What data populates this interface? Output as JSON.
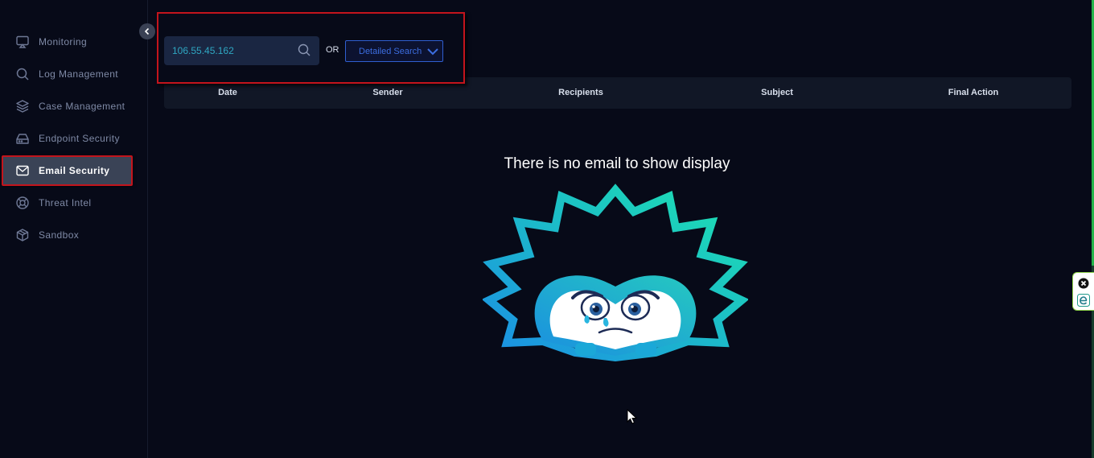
{
  "sidebar": {
    "items": [
      {
        "label": "Monitoring",
        "icon": "monitor-icon"
      },
      {
        "label": "Log Management",
        "icon": "search-icon"
      },
      {
        "label": "Case Management",
        "icon": "layers-icon"
      },
      {
        "label": "Endpoint Security",
        "icon": "hard-drive-icon"
      },
      {
        "label": "Email Security",
        "icon": "mail-icon",
        "active": true
      },
      {
        "label": "Threat Intel",
        "icon": "lifebuoy-icon"
      },
      {
        "label": "Sandbox",
        "icon": "box-icon"
      }
    ]
  },
  "search": {
    "value": "106.55.45.162",
    "or_label": "OR",
    "detailed_search_label": "Detailed Search"
  },
  "table": {
    "columns": [
      "Date",
      "Sender",
      "Recipients",
      "Subject",
      "Final Action"
    ]
  },
  "empty_state": {
    "message": "There is no email to show display"
  },
  "colors": {
    "background": "#070a18",
    "accent_highlight": "#c3141c",
    "search_text": "#2fa7c2",
    "select_border": "#2f5fd0"
  }
}
